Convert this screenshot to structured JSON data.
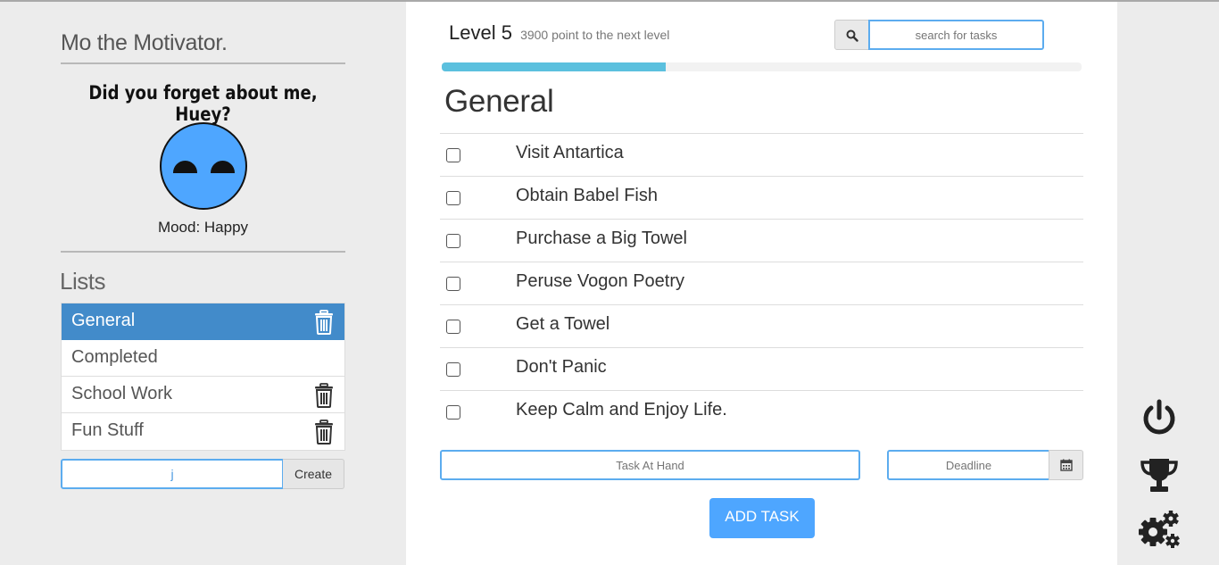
{
  "sidebar": {
    "brand": "Mo the Motivator.",
    "mo_message": "Did you forget about me, Huey?",
    "mood": "Mood: Happy",
    "lists_title": "Lists",
    "lists": [
      {
        "label": "General",
        "active": true,
        "deletable": true
      },
      {
        "label": "Completed",
        "active": false,
        "deletable": false
      },
      {
        "label": "School Work",
        "active": false,
        "deletable": true
      },
      {
        "label": "Fun Stuff",
        "active": false,
        "deletable": true
      }
    ],
    "new_list_value": "j",
    "create_label": "Create"
  },
  "header": {
    "level": "Level 5",
    "points_to_next": "3900 point to the next level",
    "search_placeholder": "search for tasks",
    "progress_fraction": 0.35
  },
  "main": {
    "list_heading": "General",
    "tasks": [
      "Visit Antartica",
      "Obtain Babel Fish",
      "Purchase a Big Towel",
      "Peruse Vogon Poetry",
      "Get a Towel",
      "Don't Panic",
      "Keep Calm and Enjoy Life."
    ],
    "task_placeholder": "Task At Hand",
    "deadline_placeholder": "Deadline",
    "add_task_label": "ADD TASK"
  },
  "rail": {
    "icons": [
      "power-icon",
      "trophy-icon",
      "gears-icon"
    ]
  },
  "colors": {
    "accent": "#4ea6ff",
    "active_list": "#428bca",
    "progress": "#5bc0de",
    "input_border": "#5cacef"
  }
}
